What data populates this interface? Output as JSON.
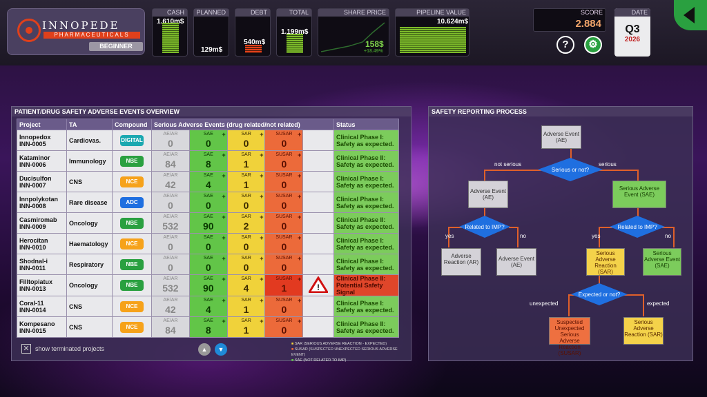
{
  "brand": {
    "name": "INNOPEDE",
    "sub": "PHARMACEUTICALS",
    "level": "BEGINNER"
  },
  "kpis": {
    "cash": {
      "label": "CASH",
      "value": "1.610m$"
    },
    "planned": {
      "label": "PLANNED",
      "value": "129m$"
    },
    "debt": {
      "label": "DEBT",
      "value": "540m$"
    },
    "total": {
      "label": "TOTAL",
      "value": "1.199m$"
    },
    "share": {
      "label": "SHARE PRICE",
      "value": "158$",
      "change": "+18.49%"
    },
    "pipeline": {
      "label": "PIPELINE VALUE",
      "value": "10.624m$"
    }
  },
  "score": {
    "label": "SCORE",
    "value": "2.884"
  },
  "date": {
    "label": "DATE",
    "quarter": "Q3",
    "year": "2026"
  },
  "help_icon": "question-icon",
  "settings_icon": "gear-icon",
  "left_panel": {
    "title": "PATIENT/DRUG SAFETY ADVERSE EVENTS OVERVIEW",
    "headers": {
      "project": "Project",
      "ta": "TA",
      "compound": "Compound",
      "events": "Serious Adverse Events (drug related/not related)",
      "status": "Status"
    },
    "labels": {
      "ae": "AE/AR",
      "sae": "SAE",
      "sar": "SAR",
      "susar": "SUSAR"
    },
    "rows": [
      {
        "name": "Innopedox",
        "code": "INN-0005",
        "ta": "Cardiovas.",
        "compound": "DIGITAL",
        "ctype": "digital",
        "ae": "0",
        "sae": "0",
        "sar": "0",
        "susar": "0",
        "warn": false,
        "status1": "Clinical Phase I:",
        "status2": "Safety as expected.",
        "status3": ""
      },
      {
        "name": "Kataminor",
        "code": "INN-0006",
        "ta": "Immunology",
        "compound": "NBE",
        "ctype": "nbe",
        "ae": "84",
        "sae": "8",
        "sar": "1",
        "susar": "0",
        "warn": false,
        "status1": "Clinical Phase II:",
        "status2": "Safety as expected.",
        "status3": ""
      },
      {
        "name": "Ducisulfon",
        "code": "INN-0007",
        "ta": "CNS",
        "compound": "NCE",
        "ctype": "nce",
        "ae": "42",
        "sae": "4",
        "sar": "1",
        "susar": "0",
        "warn": false,
        "status1": "Clinical Phase I:",
        "status2": "Safety as expected.",
        "status3": ""
      },
      {
        "name": "Innpolykotan",
        "code": "INN-0008",
        "ta": "Rare disease",
        "compound": "ADC",
        "ctype": "adc",
        "ae": "0",
        "sae": "0",
        "sar": "0",
        "susar": "0",
        "warn": false,
        "status1": "Clinical Phase I:",
        "status2": "Safety as expected.",
        "status3": ""
      },
      {
        "name": "Casmiromab",
        "code": "INN-0009",
        "ta": "Oncology",
        "compound": "NBE",
        "ctype": "nbe",
        "ae": "532",
        "sae": "90",
        "sar": "2",
        "susar": "0",
        "warn": false,
        "status1": "Clinical Phase II:",
        "status2": "Safety as expected.",
        "status3": ""
      },
      {
        "name": "Herocitan",
        "code": "INN-0010",
        "ta": "Haematology",
        "compound": "NCE",
        "ctype": "nce",
        "ae": "0",
        "sae": "0",
        "sar": "0",
        "susar": "0",
        "warn": false,
        "status1": "Clinical Phase I:",
        "status2": "Safety as expected.",
        "status3": ""
      },
      {
        "name": "Shodnal-i",
        "code": "INN-0011",
        "ta": "Respiratory",
        "compound": "NBE",
        "ctype": "nbe",
        "ae": "0",
        "sae": "0",
        "sar": "0",
        "susar": "0",
        "warn": false,
        "status1": "Clinical Phase I:",
        "status2": "Safety as expected.",
        "status3": ""
      },
      {
        "name": "Filltopiatux",
        "code": "INN-0013",
        "ta": "Oncology",
        "compound": "NBE",
        "ctype": "nbe",
        "ae": "532",
        "sae": "90",
        "sar": "4",
        "susar": "1",
        "warn": true,
        "status1": "Clinical Phase II:",
        "status2": "Potential Safety",
        "status3": "Signal"
      },
      {
        "name": "Coral-11",
        "code": "INN-0014",
        "ta": "CNS",
        "compound": "NCE",
        "ctype": "nce",
        "ae": "42",
        "sae": "4",
        "sar": "1",
        "susar": "0",
        "warn": false,
        "status1": "Clinical Phase I:",
        "status2": "Safety as expected.",
        "status3": ""
      },
      {
        "name": "Kompesano",
        "code": "INN-0015",
        "ta": "CNS",
        "compound": "NCE",
        "ctype": "nce",
        "ae": "84",
        "sae": "8",
        "sar": "1",
        "susar": "0",
        "warn": false,
        "status1": "Clinical Phase II:",
        "status2": "Safety as expected.",
        "status3": ""
      }
    ],
    "show_terminated": "show terminated projects",
    "legend": [
      "SAR (SERIOUS ADVERSE REACTION - EXPECTED)",
      "SUSAR (SUSPECTED UNEXPECTED SERIOUS ADVERSE EVENT)",
      "SAE (NOT RELATED TO IMP)"
    ]
  },
  "right_panel": {
    "title": "SAFETY REPORTING PROCESS",
    "ae_top": "Adverse Event (AE)",
    "serious_q": "Serious or not?",
    "not_serious": "not serious",
    "serious": "serious",
    "ae_left": "Adverse Event (AE)",
    "sae_right": "Serious Adverse Event (SAE)",
    "related_q": "Related to IMP?",
    "yes": "yes",
    "no": "no",
    "ar": "Adverse Reaction (AR)",
    "ae_mid": "Adverse Event (AE)",
    "sar": "Serious Adverse Reaction (SAR)",
    "sae_low": "Serious Adverse Event (SAE)",
    "expected_q": "Expected or not?",
    "unexpected": "unexpected",
    "expected": "expected",
    "susar": "Suspected Unexpected Serious Adverse Reaction (SUSAR)",
    "sar_low": "Serious Adverse Reaction (SAR)"
  }
}
